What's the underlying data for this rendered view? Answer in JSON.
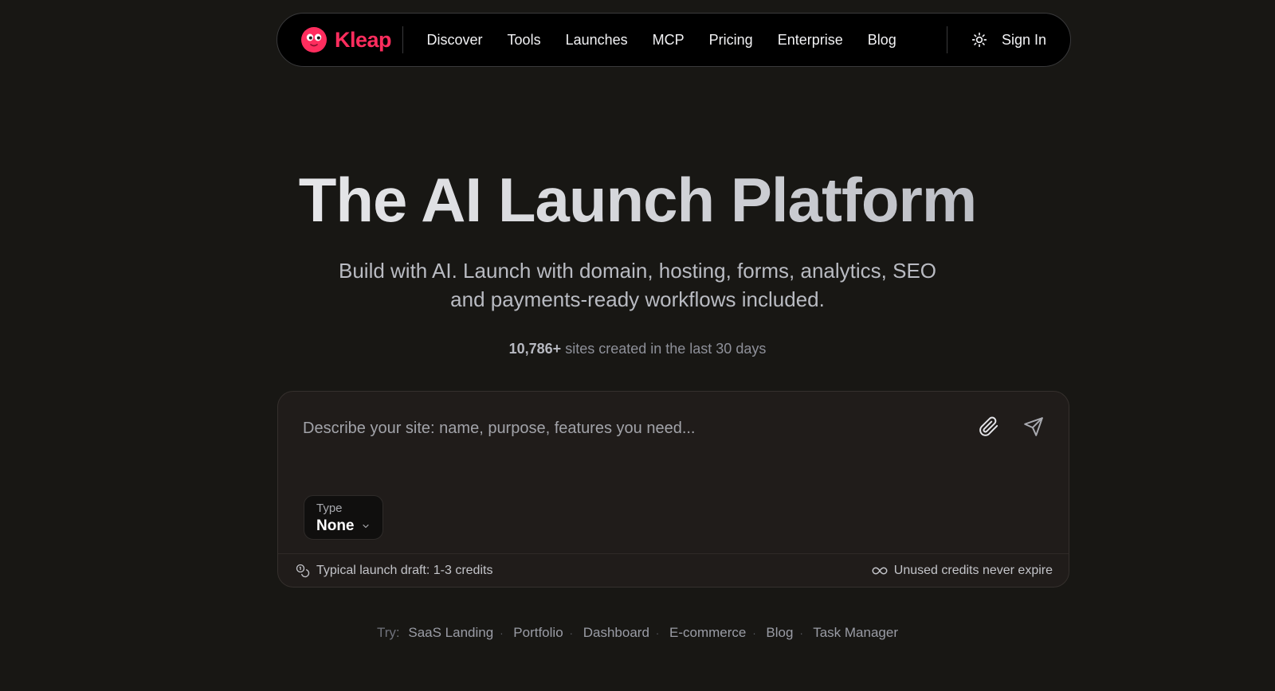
{
  "colors": {
    "brand": "#ff2d5e",
    "background": "#181714",
    "nav_bg": "#000000"
  },
  "nav": {
    "brand": "Kleap",
    "links": [
      "Discover",
      "Tools",
      "Launches",
      "MCP",
      "Pricing",
      "Enterprise",
      "Blog"
    ],
    "theme_icon": "sun-icon",
    "sign_in": "Sign In"
  },
  "hero": {
    "title": "The AI Launch Platform",
    "subtitle_line1": "Build with AI. Launch with domain, hosting, forms, analytics, SEO",
    "subtitle_line2": "and payments-ready workflows included.",
    "stat_count": "10,786+",
    "stat_text": " sites created in the last 30 days"
  },
  "prompt": {
    "placeholder": "Describe your site: name, purpose, features you need...",
    "attach_icon": "paperclip-icon",
    "send_icon": "send-icon",
    "type_label": "Type",
    "type_value": "None",
    "footer_left": "Typical launch draft: 1-3 credits",
    "footer_right": "Unused credits never expire"
  },
  "try": {
    "label": "Try:",
    "items": [
      "SaaS Landing",
      "Portfolio",
      "Dashboard",
      "E-commerce",
      "Blog",
      "Task Manager"
    ]
  }
}
